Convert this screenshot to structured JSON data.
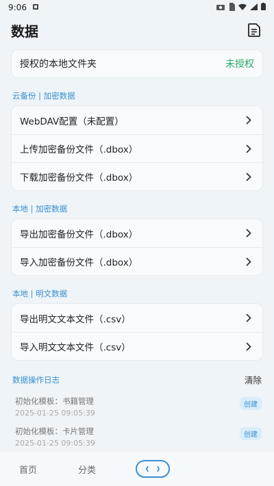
{
  "status_bar": {
    "time": "9:06"
  },
  "header": {
    "title": "数据"
  },
  "auth": {
    "label": "授权的本地文件夹",
    "status": "未授权"
  },
  "cloud_section": {
    "label": "云备份 | 加密数据",
    "items": [
      {
        "label": "WebDAV配置（未配置）"
      },
      {
        "label": "上传加密备份文件（.dbox）"
      },
      {
        "label": "下载加密备份文件（.dbox）"
      }
    ]
  },
  "local_encrypted_section": {
    "label": "本地 | 加密数据",
    "items": [
      {
        "label": "导出加密备份文件（.dbox）"
      },
      {
        "label": "导入加密备份文件（.dbox）"
      }
    ]
  },
  "local_plain_section": {
    "label": "本地 | 明文数据",
    "items": [
      {
        "label": "导出明文文本文件（.csv）"
      },
      {
        "label": "导入明文文本文件（.csv）"
      }
    ]
  },
  "log": {
    "title": "数据操作日志",
    "clear_label": "清除",
    "entries": [
      {
        "name": "初始化模板：书籍管理",
        "time": "2025-01-25 09:05:39",
        "badge": "创建"
      },
      {
        "name": "初始化模板：卡片管理",
        "time": "2025-01-25 09:05:39",
        "badge": "创建"
      }
    ]
  },
  "bottom_nav": {
    "home": "首页",
    "category": "分类"
  }
}
